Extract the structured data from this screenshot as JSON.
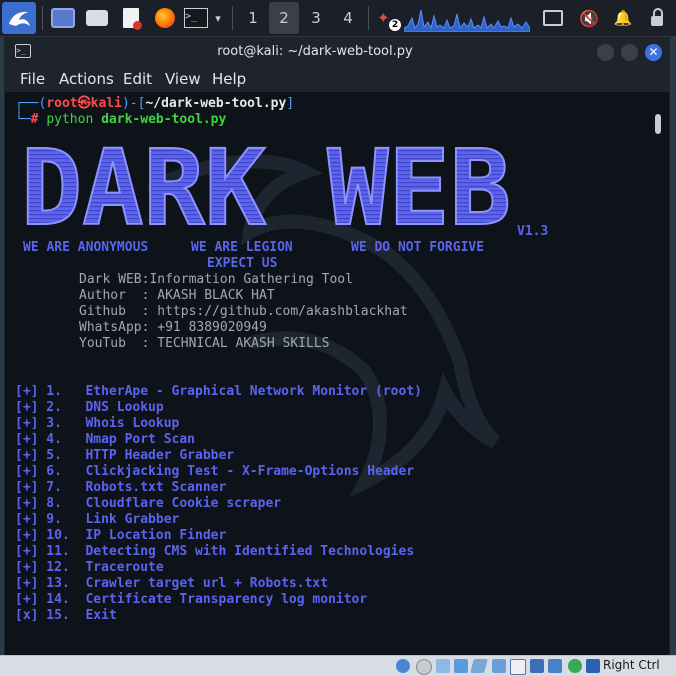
{
  "panel": {
    "workspaces": [
      "1",
      "2",
      "3",
      "4"
    ],
    "active_workspace": "2",
    "notification_count": "2"
  },
  "window": {
    "title": "root@kali: ~/dark-web-tool.py",
    "menu": [
      "File",
      "Actions",
      "Edit",
      "View",
      "Help"
    ]
  },
  "terminal": {
    "prompt": {
      "open": "┌──(",
      "user": "root",
      "at": "㉿",
      "host": "kali",
      "mid": ")-[",
      "path": "~/dark-web-tool.py",
      "close": "]",
      "line2_prefix": "└─",
      "hash": "#",
      "cmd": "python",
      "arg": "dark-web-tool.py"
    },
    "banner_title": "DARK WEB",
    "version": "V1.3",
    "slogan1": "WE ARE ANONYMOUS",
    "slogan2": "WE ARE LEGION",
    "slogan3": "WE DO NOT FORGIVE",
    "slogan4": "EXPECT US",
    "info": [
      "Dark WEB:Information Gathering Tool",
      "Author  : AKASH BLACK HAT",
      "Github  : https://github.com/akashblackhat",
      "WhatsApp: +91 8389020949",
      "YouTub  : TECHNICAL AKASH SKILLS"
    ],
    "menu_items": [
      "[+] 1.   EtherApe - Graphical Network Monitor (root)",
      "[+] 2.   DNS Lookup",
      "[+] 3.   Whois Lookup",
      "[+] 4.   Nmap Port Scan",
      "[+] 5.   HTTP Header Grabber",
      "[+] 6.   Clickjacking Test - X-Frame-Options Header",
      "[+] 7.   Robots.txt Scanner",
      "[+] 8.   Cloudflare Cookie scraper",
      "[+] 9.   Link Grabber",
      "[+] 10.  IP Location Finder",
      "[+] 11.  Detecting CMS with Identified Technologies",
      "[+] 12.  Traceroute",
      "[+] 13.  Crawler target url + Robots.txt",
      "[+] 14.  Certificate Transparency log monitor",
      "[x] 15.  Exit"
    ]
  },
  "statusbar": {
    "host_key": "Right Ctrl"
  }
}
